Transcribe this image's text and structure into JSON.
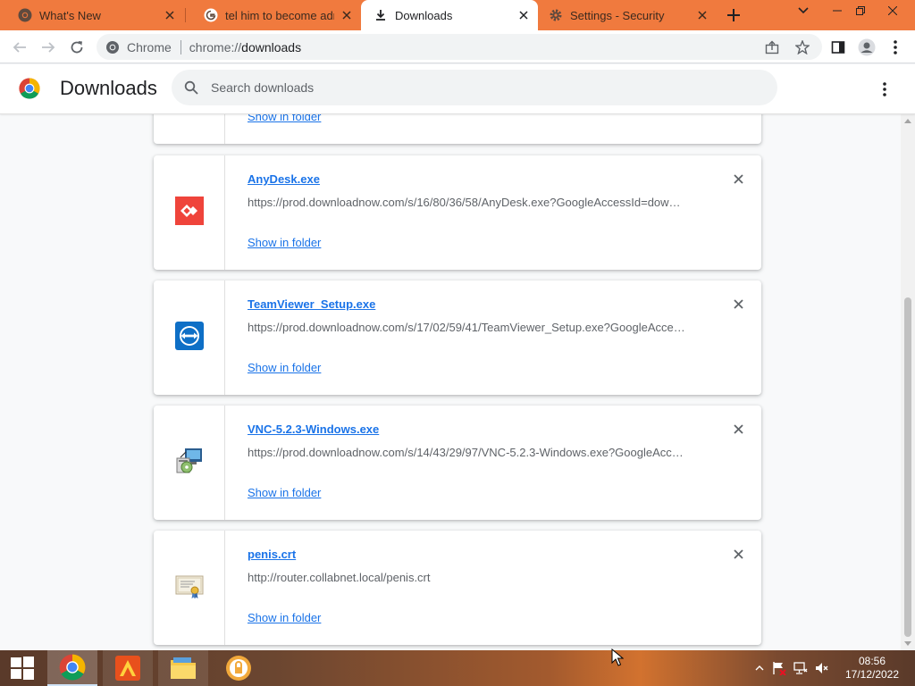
{
  "tabs": [
    {
      "title": "What's New",
      "icon": "chrome-icon",
      "active": false
    },
    {
      "title": "tel him to become admin",
      "icon": "google-icon",
      "active": false
    },
    {
      "title": "Downloads",
      "icon": "download-icon",
      "active": true
    },
    {
      "title": "Settings - Security",
      "icon": "gear-icon",
      "active": false
    }
  ],
  "omnibox": {
    "site_label": "Chrome",
    "url_scheme": "chrome://",
    "url_host": "downloads"
  },
  "header": {
    "title": "Downloads",
    "search_placeholder": "Search downloads"
  },
  "partial_item": {
    "show_in_folder": "Show in folder"
  },
  "downloads": [
    {
      "file_name": "AnyDesk.exe",
      "url": "https://prod.downloadnow.com/s/16/80/36/58/AnyDesk.exe?GoogleAccessId=dow…",
      "show_in_folder": "Show in folder",
      "icon": "anydesk-icon"
    },
    {
      "file_name": "TeamViewer_Setup.exe",
      "url": "https://prod.downloadnow.com/s/17/02/59/41/TeamViewer_Setup.exe?GoogleAcce…",
      "show_in_folder": "Show in folder",
      "icon": "teamviewer-icon"
    },
    {
      "file_name": "VNC-5.2.3-Windows.exe",
      "url": "https://prod.downloadnow.com/s/14/43/29/97/VNC-5.2.3-Windows.exe?GoogleAcc…",
      "show_in_folder": "Show in folder",
      "icon": "installer-icon"
    },
    {
      "file_name": "penis.crt",
      "url": "http://router.collabnet.local/penis.crt",
      "show_in_folder": "Show in folder",
      "icon": "certificate-icon"
    }
  ],
  "clock": {
    "time": "08:56",
    "date": "17/12/2022"
  },
  "colors": {
    "tabstrip": "#f07a3e",
    "link": "#1a73e8",
    "anydesk": "#ef443b",
    "teamviewer": "#0e6fc6"
  }
}
